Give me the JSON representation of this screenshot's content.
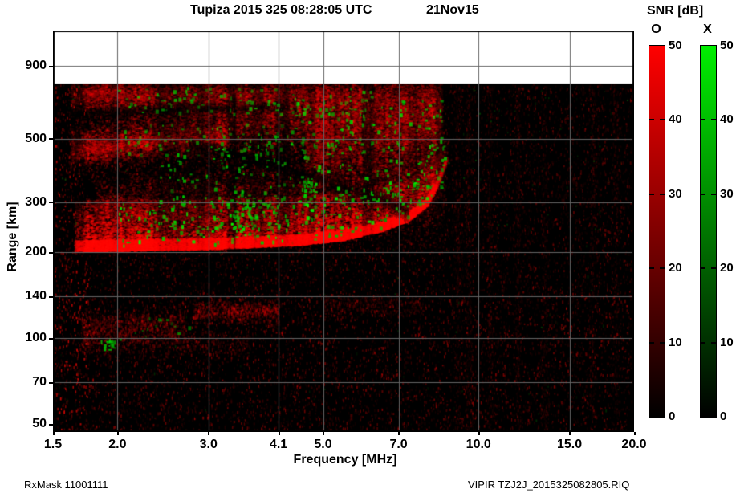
{
  "title": {
    "main": "Tupiza 2015 325 08:28:05 UTC",
    "date": "21Nov15"
  },
  "footer": {
    "left": "RxMask 11001111",
    "right": "VIPIR  TZJ2J_2015325082805.RIQ"
  },
  "colorbar": {
    "title": "SNR [dB]",
    "o_label": "O",
    "x_label": "X",
    "min": 0,
    "max": 50,
    "ticks": [
      0,
      10,
      20,
      30,
      40,
      50
    ],
    "o_color": "#ff0000",
    "x_color": "#00ee00"
  },
  "chart_data": {
    "type": "heatmap",
    "title": "Tupiza 2015 325 08:28:05 UTC 21Nov15",
    "xlabel": "Frequency [MHz]",
    "ylabel": "Range [km]",
    "x_scale": "log",
    "y_scale": "log",
    "xlim": [
      1.5,
      20
    ],
    "ylim": [
      47,
      1197
    ],
    "x_ticks": [
      1.5,
      2.0,
      3.0,
      4.1,
      5.0,
      7.0,
      10.0,
      15.0,
      20.0
    ],
    "x_tick_labels": [
      "1.5",
      "2.0",
      "3.0",
      "4.1",
      "5.0",
      "7.0",
      "10.0",
      "15.0",
      "20.0"
    ],
    "y_ticks": [
      50,
      70,
      100,
      140,
      200,
      300,
      500,
      900
    ],
    "grid_x": [
      2.0,
      3.0,
      4.1,
      5.0,
      7.0,
      10.0,
      15.0
    ],
    "grid_y": [
      70,
      100,
      140,
      200,
      300,
      500,
      900
    ],
    "grid_color": "#646464",
    "background": "#000000",
    "no_data_above_km": 780,
    "snr_db_range": [
      0,
      50
    ],
    "features": {
      "main_trace": {
        "f": [
          1.65,
          8.65
        ],
        "edge": [
          [
            1.65,
            206
          ],
          [
            2.2,
            208
          ],
          [
            3.0,
            210
          ],
          [
            4.5,
            217
          ],
          [
            5.5,
            226
          ],
          [
            6.5,
            243
          ],
          [
            7.3,
            263
          ],
          [
            7.9,
            296
          ],
          [
            8.3,
            345
          ],
          [
            8.65,
            420
          ]
        ],
        "core_km": 24,
        "tail_km": 80,
        "amp": 1.0,
        "n": 15000
      },
      "bands": [
        {
          "name": "top-band",
          "f": [
            1.62,
            8.45
          ],
          "km": [
            705,
            685
          ],
          "spread": [
            50,
            85
          ],
          "amp": 0.5,
          "n": 9000
        },
        {
          "name": "top-band-bright",
          "f": [
            1.7,
            6.2
          ],
          "km": [
            725,
            700
          ],
          "spread": [
            28,
            40
          ],
          "amp": 0.45,
          "n": 3000
        },
        {
          "name": "second-band",
          "f": [
            1.62,
            8.45
          ],
          "km": [
            470,
            640
          ],
          "spread": [
            38,
            85
          ],
          "amp": 0.55,
          "n": 9000
        },
        {
          "name": "second-band-left",
          "f": [
            1.62,
            3.3
          ],
          "km": [
            450,
            515
          ],
          "spread": [
            20,
            26
          ],
          "amp": 0.6,
          "n": 2200
        },
        {
          "name": "mid-diffuse",
          "f": [
            1.8,
            8.55
          ],
          "km": [
            275,
            350
          ],
          "spread": [
            40,
            65
          ],
          "amp": 0.45,
          "n": 8000
        },
        {
          "name": "right-mass",
          "f": [
            4.6,
            8.5
          ],
          "km": [
            460,
            530
          ],
          "spread": [
            80,
            95
          ],
          "amp": 0.5,
          "n": 7000
        }
      ],
      "low_patches": [
        {
          "f": [
            1.7,
            2.7
          ],
          "km": [
            100,
            122
          ],
          "amp": 0.22,
          "n": 800
        },
        {
          "f": [
            2.8,
            4.1
          ],
          "km": [
            118,
            132
          ],
          "amp": 0.25,
          "n": 700
        },
        {
          "f": [
            1.7,
            3.6
          ],
          "km": [
            90,
            104
          ],
          "amp": 0.18,
          "n": 500
        },
        {
          "f": [
            5.0,
            7.8
          ],
          "km": [
            125,
            138
          ],
          "amp": 0.14,
          "n": 350
        }
      ],
      "dark_lanes": [
        {
          "f": [
            2.75,
            7.3
          ],
          "km": [
            480,
            280
          ],
          "half_km": 26,
          "a": 0.7
        },
        {
          "f": [
            1.62,
            4.3
          ],
          "km": [
            612,
            648
          ],
          "half_km": 26,
          "a": 0.55
        }
      ],
      "dark_stripes": [
        {
          "f": 3.36,
          "w": 9,
          "a": 0.85
        },
        {
          "f": 3.52,
          "w": 3,
          "a": 0.6
        },
        {
          "f": 2.62,
          "w": 3,
          "a": 0.5
        },
        {
          "f": 2.07,
          "w": 2,
          "a": 0.4
        },
        {
          "f": 5.62,
          "w": 4,
          "a": 0.7
        },
        {
          "f": 5.95,
          "w": 5,
          "a": 0.75
        },
        {
          "f": 6.15,
          "w": 3,
          "a": 0.6
        },
        {
          "f": 6.55,
          "w": 3,
          "a": 0.5
        },
        {
          "f": 7.28,
          "w": 3,
          "a": 0.55
        },
        {
          "f": 7.62,
          "w": 7,
          "a": 0.5
        },
        {
          "f": 8.05,
          "w": 3,
          "a": 0.45
        }
      ],
      "green_clusters": [
        {
          "name": "above-trace",
          "f": [
            2.0,
            8.6
          ],
          "above_trace_km": [
            4,
            95
          ],
          "n": 280,
          "bright": 0.95
        },
        {
          "name": "upper-right",
          "f": [
            4.3,
            8.6
          ],
          "km": [
            300,
            690
          ],
          "n": 200,
          "bright": 0.85
        },
        {
          "name": "mid-left",
          "f": [
            2.4,
            4.2
          ],
          "km": [
            240,
            490
          ],
          "n": 120,
          "bright": 0.8
        },
        {
          "name": "clump-3p4",
          "f": [
            3.3,
            3.6
          ],
          "km": [
            225,
            330
          ],
          "n": 34,
          "bright": 1.0
        },
        {
          "name": "clump-4p6",
          "f": [
            4.5,
            4.85
          ],
          "km": [
            295,
            375
          ],
          "n": 28,
          "bright": 1.0
        },
        {
          "name": "top-band",
          "f": [
            2.0,
            6.2
          ],
          "km": [
            615,
            760
          ],
          "n": 90,
          "bright": 0.7
        },
        {
          "name": "second-band",
          "f": [
            2.0,
            4.6
          ],
          "km": [
            430,
            570
          ],
          "n": 70,
          "bright": 0.7
        },
        {
          "name": "low-left-blob",
          "f": [
            1.85,
            2.02
          ],
          "km": [
            91,
            100
          ],
          "n": 16,
          "bright": 0.95
        },
        {
          "name": "low-left-bits",
          "f": [
            2.1,
            2.75
          ],
          "km": [
            104,
            120
          ],
          "n": 12,
          "bright": 0.6
        },
        {
          "name": "sparse",
          "f": [
            1.6,
            19.5
          ],
          "km": [
            50,
            750
          ],
          "n": 120,
          "bright": 0.3
        }
      ],
      "column_noise": [
        {
          "f": 9.1,
          "amp": 0.1
        },
        {
          "f": 9.55,
          "amp": 0.13
        },
        {
          "f": 10.5,
          "amp": 0.09
        },
        {
          "f": 11.9,
          "amp": 0.1
        },
        {
          "f": 13.4,
          "amp": 0.08
        },
        {
          "f": 16.6,
          "amp": 0.1
        },
        {
          "f": 18.4,
          "amp": 0.09
        }
      ],
      "noise": {
        "n": 15000,
        "amp": 0.3,
        "green_fraction": 0.025
      }
    }
  }
}
